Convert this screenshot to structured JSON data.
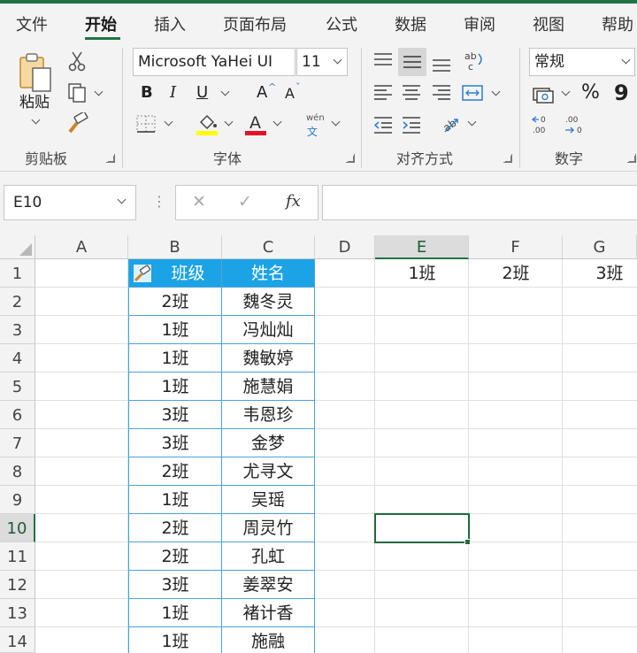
{
  "menu": {
    "tabs": [
      {
        "label": "文件"
      },
      {
        "label": "开始"
      },
      {
        "label": "插入"
      },
      {
        "label": "页面布局"
      },
      {
        "label": "公式"
      },
      {
        "label": "数据"
      },
      {
        "label": "审阅"
      },
      {
        "label": "视图"
      },
      {
        "label": "帮助"
      }
    ],
    "active_tab": "开始"
  },
  "ribbon": {
    "clipboard": {
      "paste_label": "粘贴",
      "group_label": "剪贴板"
    },
    "font": {
      "font_name": "Microsoft YaHei UI",
      "font_size": "11",
      "bold": "B",
      "italic": "I",
      "underline": "U",
      "grow": "A",
      "shrink": "A",
      "group_label": "字体",
      "phonetic_top": "wén",
      "phonetic_bottom": "文"
    },
    "alignment": {
      "group_label": "对齐方式"
    },
    "number": {
      "format": "常规",
      "percent": "%",
      "comma": "9",
      "group_label": "数字"
    }
  },
  "formula_bar": {
    "name_box": "E10",
    "cancel": "✕",
    "enter": "✓",
    "fx": "fx",
    "formula": ""
  },
  "sheet": {
    "columns": [
      "A",
      "B",
      "C",
      "D",
      "E",
      "F",
      "G"
    ],
    "rows": [
      "1",
      "2",
      "3",
      "4",
      "5",
      "6",
      "7",
      "8",
      "9",
      "10",
      "11",
      "12",
      "13",
      "14"
    ],
    "selected_cell": "E10",
    "table_header": {
      "b": "班级",
      "c": "姓名"
    },
    "table_rows": [
      {
        "b": "2班",
        "c": "魏冬灵"
      },
      {
        "b": "1班",
        "c": "冯灿灿"
      },
      {
        "b": "1班",
        "c": "魏敏婷"
      },
      {
        "b": "1班",
        "c": "施慧娟"
      },
      {
        "b": "3班",
        "c": "韦恩珍"
      },
      {
        "b": "3班",
        "c": "金梦"
      },
      {
        "b": "2班",
        "c": "尤寻文"
      },
      {
        "b": "1班",
        "c": "吴瑶"
      },
      {
        "b": "2班",
        "c": "周灵竹"
      },
      {
        "b": "2班",
        "c": "孔虹"
      },
      {
        "b": "3班",
        "c": "姜翠安"
      },
      {
        "b": "1班",
        "c": "褚计香"
      },
      {
        "b": "1班",
        "c": "施融"
      }
    ],
    "e1": "1班",
    "f1": "2班",
    "g1": "3班"
  },
  "colors": {
    "accent": "#217346",
    "table_header": "#1ca3e6",
    "table_border": "#4aa3d8"
  }
}
